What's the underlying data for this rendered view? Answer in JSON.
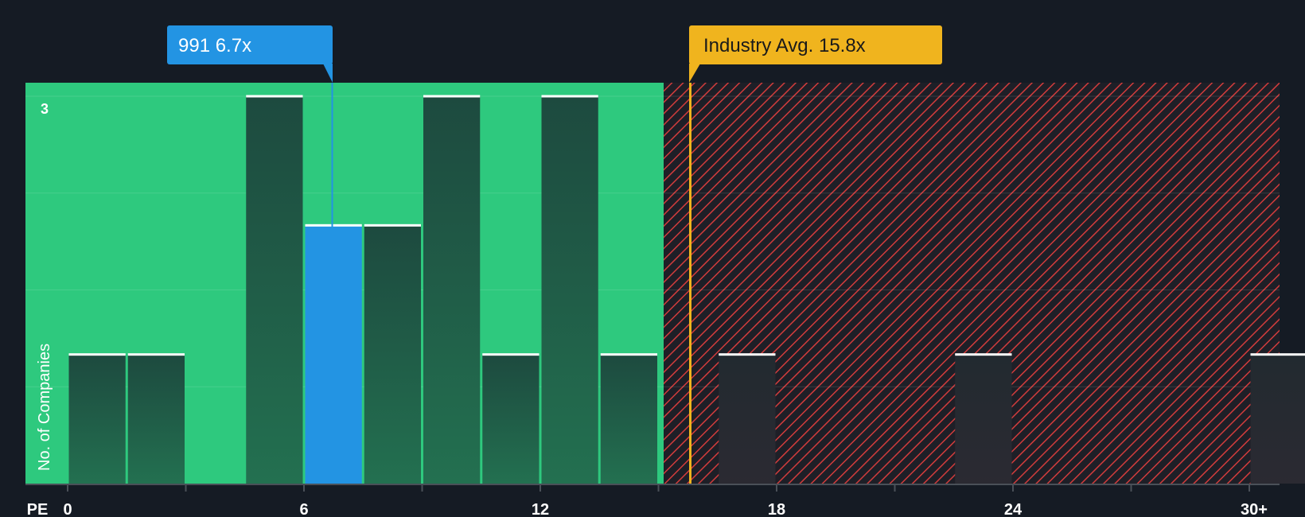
{
  "chart_data": {
    "type": "bar",
    "title": "",
    "xlabel": "PE",
    "ylabel": "No. of Companies",
    "ylim": [
      0,
      3
    ],
    "ytick_labels": [
      "3"
    ],
    "xtick_labels": [
      "0",
      "6",
      "12",
      "18",
      "24",
      "30+"
    ],
    "bin_width": 1.5,
    "bars": [
      {
        "x_start": 0,
        "value": 1
      },
      {
        "x_start": 1.5,
        "value": 1
      },
      {
        "x_start": 3,
        "value": 0
      },
      {
        "x_start": 4.5,
        "value": 3
      },
      {
        "x_start": 6,
        "value": 2,
        "highlight": true
      },
      {
        "x_start": 7.5,
        "value": 2
      },
      {
        "x_start": 9,
        "value": 3
      },
      {
        "x_start": 10.5,
        "value": 1
      },
      {
        "x_start": 12,
        "value": 3
      },
      {
        "x_start": 13.5,
        "value": 1
      },
      {
        "x_start": 16.5,
        "value": 1
      },
      {
        "x_start": 22.5,
        "value": 1
      },
      {
        "x_start": 30,
        "value": 1
      }
    ],
    "company": {
      "label": "991 6.7x",
      "value": 6.7
    },
    "industry_avg": {
      "label": "Industry Avg. 15.8x",
      "value": 15.8
    }
  },
  "colors": {
    "background": "#151b24",
    "green_zone": "#2ec97e",
    "red_hatch": "#d23c3c",
    "bar_dark": "#1e4a3e",
    "bar_highlight": "#2394e3",
    "company_callout": "#2394e3",
    "industry_callout": "#f0b41e"
  }
}
